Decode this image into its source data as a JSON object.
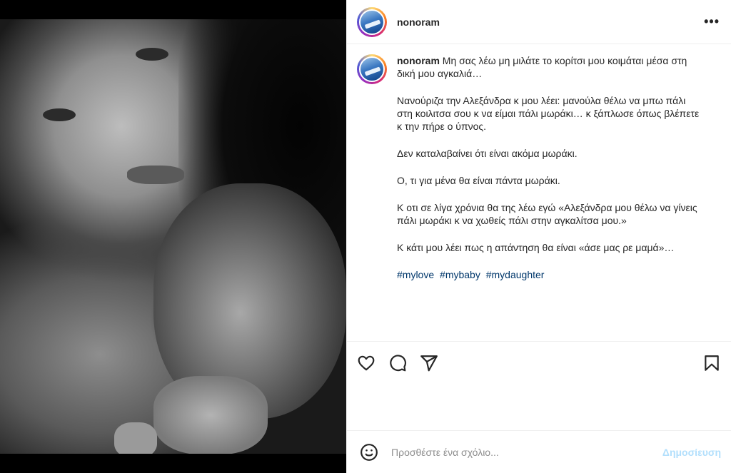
{
  "header": {
    "username": "nonoram",
    "more_label": "•••"
  },
  "caption": {
    "username": "nonoram",
    "first_line": "Μη σας λέω μη μιλάτε το κορίτσι μου κοιμάται μέσα στη δική μου αγκαλιά…",
    "paragraphs": [
      "Νανούριζα την Αλεξάνδρα κ μου λέει: μανούλα θέλω να μπω πάλι στη κοιλιτσα σου κ να είμαι πάλι μωράκι… κ ξάπλωσε όπως βλέπετε κ την πήρε ο ύπνος.",
      "Δεν καταλαβαίνει ότι είναι ακόμα μωράκι.",
      "Ο, τι για μένα θα είναι πάντα μωράκι.",
      "Κ οτι σε λίγα χρόνια θα της λέω εγώ «Αλεξάνδρα μου θέλω να γίνεις πάλι μωράκι κ να χωθείς πάλι στην αγκαλίτσα μου.»",
      "Κ κάτι μου λέει πως η απάντηση θα είναι «άσε μας ρε μαμά»…"
    ],
    "hashtags": [
      "#mylove",
      "#mybaby",
      "#mydaughter"
    ]
  },
  "actions": {
    "like_icon": "heart-icon",
    "comment_icon": "comment-icon",
    "share_icon": "share-icon",
    "save_icon": "bookmark-icon"
  },
  "comment_box": {
    "placeholder": "Προσθέστε ένα σχόλιο...",
    "post_label": "Δημοσίευση"
  },
  "colors": {
    "hashtag": "#00376b",
    "post_button_disabled": "#b2dffc",
    "text": "#262626"
  }
}
